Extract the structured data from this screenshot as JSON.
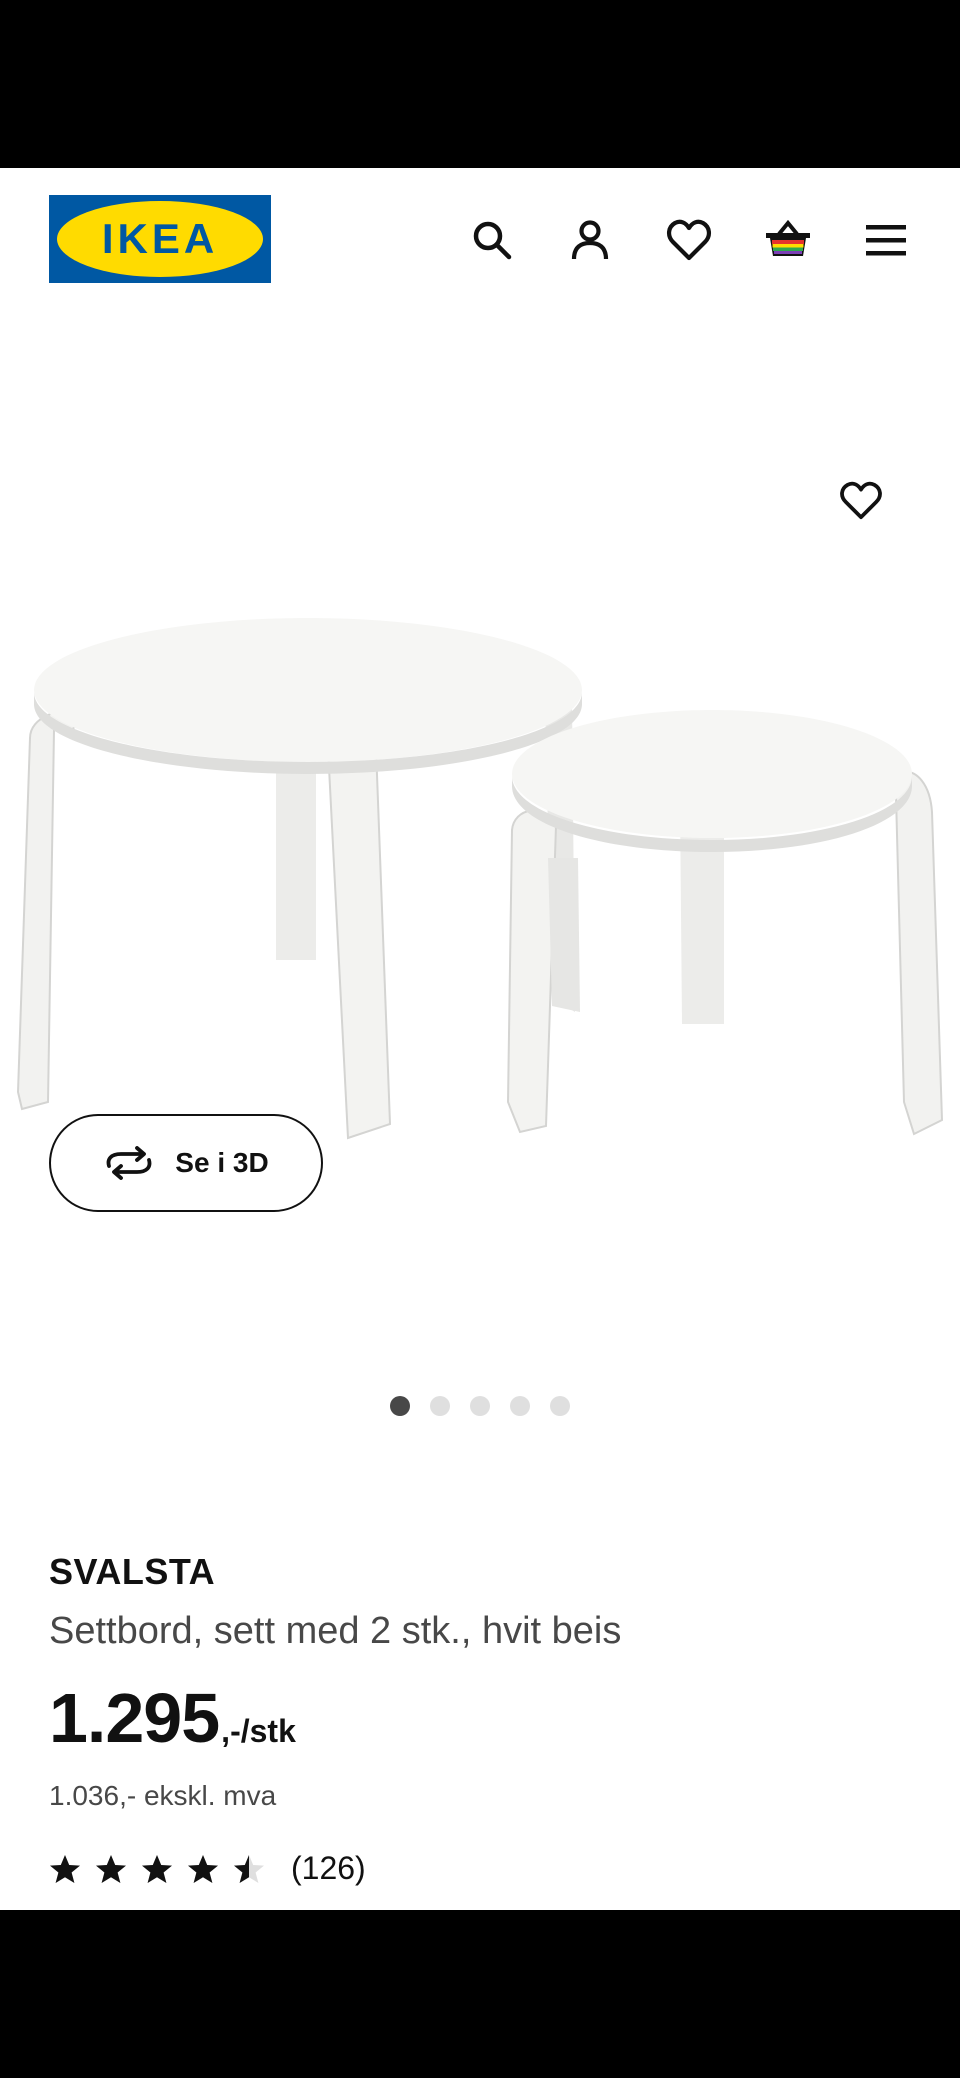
{
  "header": {
    "logo_text": "IKEA",
    "icons": [
      "search-icon",
      "account-icon",
      "wishlist-icon",
      "cart-icon",
      "menu-icon"
    ]
  },
  "media": {
    "view3d_label": "Se i 3D",
    "image_count": 5,
    "active_image": 1
  },
  "product": {
    "name": "SVALSTA",
    "description": "Settbord, sett med 2 stk., hvit beis",
    "price": "1.295",
    "price_suffix": ",-/stk",
    "price_ex_vat": "1.036,- ekskl. mva",
    "rating": 4.5,
    "rating_max": 5,
    "review_count": "(126)"
  },
  "colors": {
    "brand_blue": "#0058a3",
    "brand_yellow": "#ffdb00",
    "text": "#111111",
    "text_secondary": "#484848"
  }
}
